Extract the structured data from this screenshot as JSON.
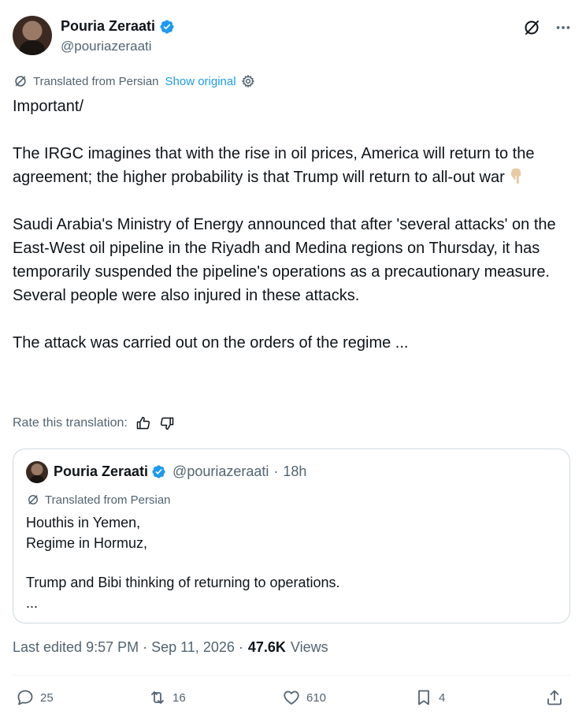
{
  "author": {
    "name": "Pouria Zeraati",
    "handle": "@pouriazeraati"
  },
  "translation": {
    "label": "Translated from Persian",
    "show_original": "Show original"
  },
  "post": {
    "line1": "Important/",
    "para2": "The IRGC imagines that with the rise in oil prices, America will return to the agreement; the higher probability is that Trump will return to all-out war",
    "para3": "Saudi Arabia's Ministry of Energy announced that after 'several attacks' on the East-West oil pipeline in the Riyadh and Medina regions on Thursday, it has temporarily suspended the pipeline's operations as a precautionary measure.",
    "para4": "Several people were also injured in these attacks.",
    "para5": "The attack was carried out on the orders of the regime ...",
    "emoji": "pointing-down-emoji"
  },
  "rate": {
    "label": "Rate this translation:"
  },
  "quote": {
    "name": "Pouria Zeraati",
    "handle": "@pouriazeraati",
    "separator": "·",
    "time": "18h",
    "translated": "Translated from Persian",
    "line1": "Houthis in Yemen,",
    "line2": "Regime in Hormuz,",
    "line3": "Trump and Bibi thinking of returning to operations.",
    "line4": "..."
  },
  "meta": {
    "edited": "Last edited 9:57 PM · Sep 11, 2026 ·",
    "views_count": "47.6K",
    "views_label": "Views"
  },
  "actions": {
    "replies": "25",
    "reposts": "16",
    "likes": "610",
    "bookmarks": "4"
  },
  "colors": {
    "link": "#1d9bf0",
    "muted": "#536471",
    "text": "#0f1419",
    "border": "#cfd9de"
  }
}
